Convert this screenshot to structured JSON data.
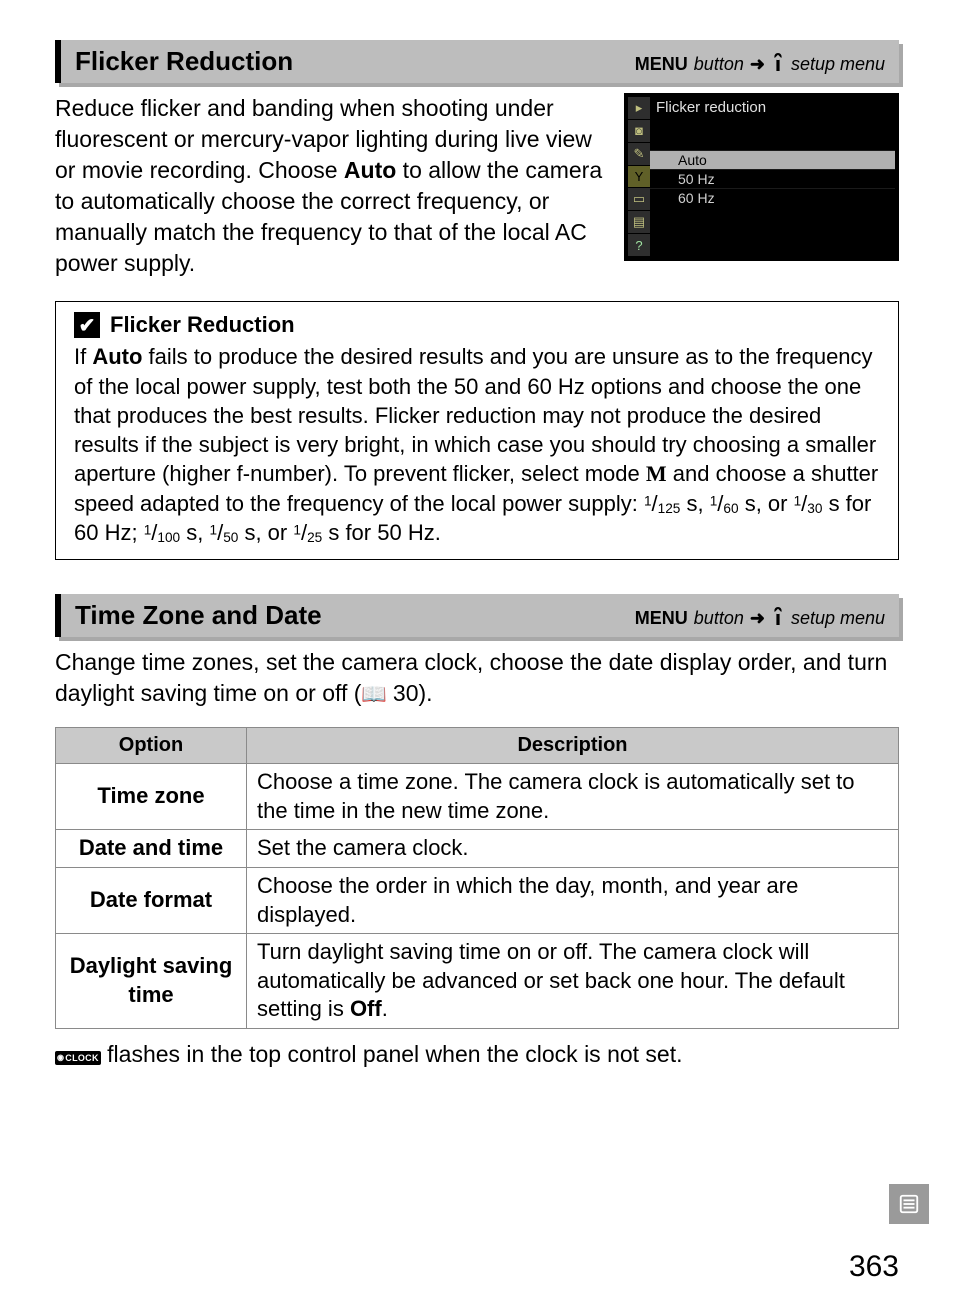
{
  "sections": {
    "flicker": {
      "title": "Flicker Reduction",
      "crumb": {
        "menu": "MENU",
        "button": "button",
        "target": "setup menu"
      },
      "intro_a": "Reduce flicker and banding when shooting under fluorescent or mercury-vapor lighting during live view or movie recording.  Choose ",
      "intro_bold": "Auto",
      "intro_b": " to allow the camera to automatically choose the correct frequency, or manually match the frequency to that of the local AC power supply.",
      "camera": {
        "title": "Flicker reduction",
        "items": [
          "Auto",
          "50 Hz",
          "60 Hz"
        ]
      },
      "note": {
        "title": "Flicker Reduction",
        "body_a": "If ",
        "body_bold1": "Auto",
        "body_b": " fails to produce the desired results and you are unsure as to the frequency of the local power supply, test both the 50 and 60 Hz options and choose the one that produces the best results.  Flicker reduction may not produce the desired results if the subject is very bright, in which case you should try choosing a smaller aperture (higher f-number).  To prevent flicker, select mode ",
        "body_mode": "M",
        "body_c": " and choose a shutter speed adapted to the frequency of the local power supply: ",
        "speeds60": "1/125 s, 1/60 s, or 1/30 s for 60 Hz;",
        "speeds50": "1/100 s, 1/50 s, or 1/25 s for 50 Hz."
      }
    },
    "time": {
      "title": "Time Zone and Date",
      "crumb": {
        "menu": "MENU",
        "button": "button",
        "target": "setup menu"
      },
      "intro_a": "Change time zones, set the camera clock, choose the date display order, and turn daylight saving time on or off (",
      "intro_ref": "30",
      "intro_b": ").",
      "table": {
        "head": [
          "Option",
          "Description"
        ],
        "rows": [
          {
            "opt": "Time zone",
            "desc": "Choose a time zone.  The camera clock is automatically set to the time in the new time zone."
          },
          {
            "opt": "Date and time",
            "desc": "Set the camera clock."
          },
          {
            "opt": "Date format",
            "desc": "Choose the order in which the day, month, and year are displayed."
          },
          {
            "opt": "Daylight saving time",
            "desc_a": "Turn daylight saving time on or off.  The camera clock will automatically be advanced or set back one hour.  The default setting is ",
            "desc_bold": "Off",
            "desc_b": "."
          }
        ]
      },
      "clock_note_a": " flashes in the top control panel when the clock is not set.",
      "clock_badge": "CLOCK"
    }
  },
  "page_number": "363",
  "chart_data": null
}
